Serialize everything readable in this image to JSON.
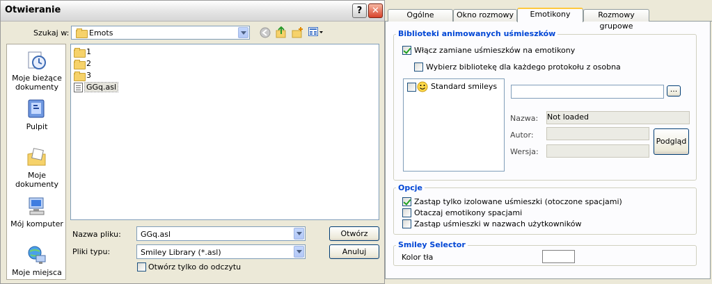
{
  "dialog": {
    "title": "Otwieranie",
    "help_label": "?",
    "close_label": "✕",
    "lookin_label": "Szukaj w:",
    "lookin_value": "Emots",
    "places": [
      {
        "label": "Moje bieżące dokumenty"
      },
      {
        "label": "Pulpit"
      },
      {
        "label": "Moje dokumenty"
      },
      {
        "label": "Mój komputer"
      },
      {
        "label": "Moje miejsca"
      }
    ],
    "files": [
      {
        "name": "1",
        "type": "folder"
      },
      {
        "name": "2",
        "type": "folder"
      },
      {
        "name": "3",
        "type": "folder"
      },
      {
        "name": "GGq.asl",
        "type": "file"
      }
    ],
    "filename_label": "Nazwa pliku:",
    "filename_value": "GGq.asl",
    "filetype_label": "Pliki typu:",
    "filetype_value": "Smiley Library (*.asl)",
    "readonly_label": "Otwórz tylko do odczytu",
    "open_button": "Otwórz",
    "cancel_button": "Anuluj"
  },
  "settings": {
    "tabs": [
      "Ogólne",
      "Okno rozmowy",
      "Emotikony",
      "Rozmowy grupowe"
    ],
    "active_tab": "Emotikony",
    "libraries_group": {
      "title": "Biblioteki animowanych uśmieszków",
      "enable_label": "Włącz zamiane uśmieszków na emotikony",
      "per_protocol_label": "Wybierz bibliotekę dla każdego protokołu z osobna",
      "list_item": "Standard smileys",
      "browse_label": "...",
      "name_label": "Nazwa:",
      "name_value": "Not loaded",
      "author_label": "Autor:",
      "version_label": "Wersja:",
      "preview_button": "Podgląd"
    },
    "options_group": {
      "title": "Opcje",
      "opt1": "Zastąp tylko izolowane uśmieszki (otoczone spacjami)",
      "opt2": "Otaczaj emotikony spacjami",
      "opt3": "Zastąp uśmieszki w nazwach użytkowników"
    },
    "selector_group": {
      "title": "Smiley Selector",
      "bg_label": "Kolor tła"
    }
  }
}
